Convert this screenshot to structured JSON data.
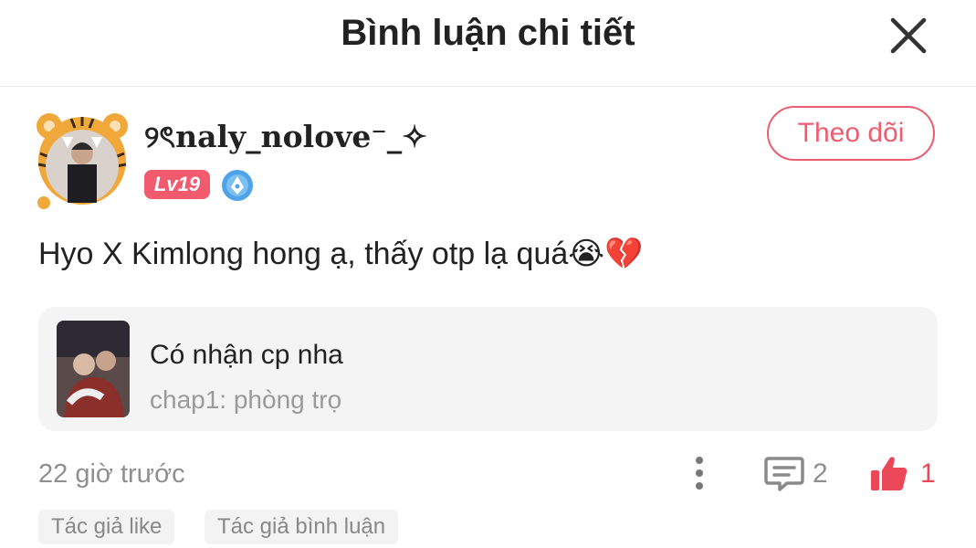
{
  "header": {
    "title": "Bình luận chi tiết"
  },
  "icons": {
    "close": "close-icon",
    "verified": "verified-badge-icon",
    "more": "more-vertical-icon",
    "reply": "comment-icon",
    "like": "thumbs-up-icon"
  },
  "comment": {
    "username": "୨ৎnaly_nolove⁻_✧",
    "level": "Lv19",
    "follow_label": "Theo dõi",
    "text": "Hyo X Kimlong hong ạ, thấy otp lạ quá😭💔",
    "timestamp": "22 giờ trước",
    "reply_count": "2",
    "like_count": "1"
  },
  "reference": {
    "title": "Có nhận cp nha",
    "subtitle": "chap1: phòng trọ"
  },
  "tags": [
    "Tác giả like",
    "Tác giả bình luận"
  ],
  "colors": {
    "accent": "#ec5d70",
    "like": "#ea4759",
    "card_bg": "#f4f4f4",
    "muted": "#8f8f8f"
  }
}
